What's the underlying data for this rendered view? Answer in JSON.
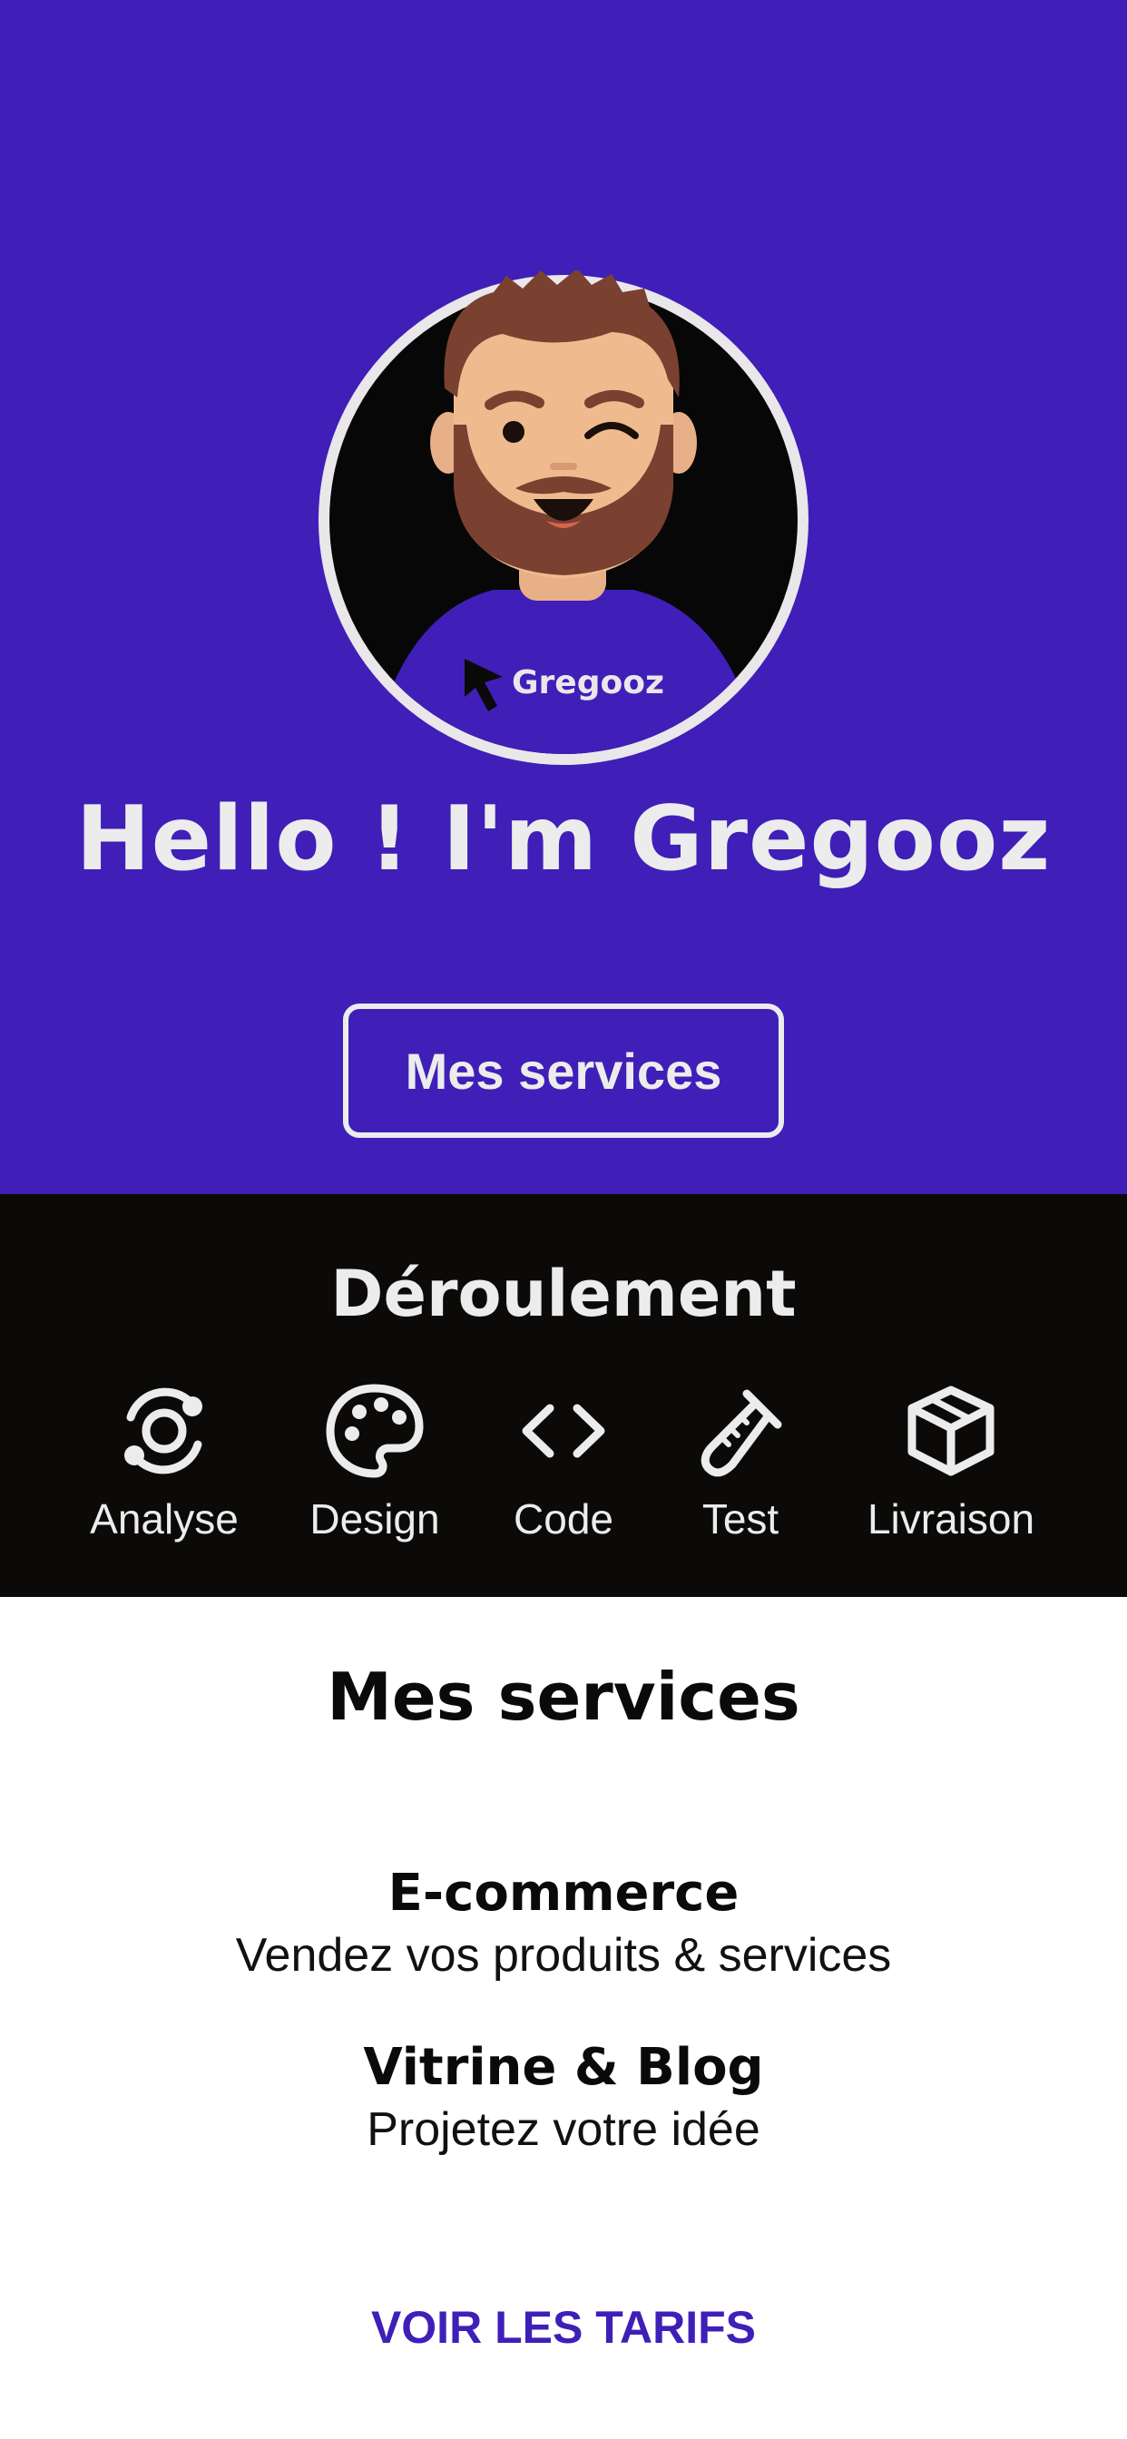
{
  "hero": {
    "title": "Hello ! I'm Gregooz",
    "button_label": "Mes services",
    "avatar_shirt_text": "Gregooz",
    "avatar_icon": "cartoon-avatar"
  },
  "process": {
    "title": "Déroulement",
    "steps": [
      {
        "label": "Analyse",
        "icon": "orbit-icon"
      },
      {
        "label": "Design",
        "icon": "palette-icon"
      },
      {
        "label": "Code",
        "icon": "code-brackets-icon"
      },
      {
        "label": "Test",
        "icon": "test-tube-icon"
      },
      {
        "label": "Livraison",
        "icon": "package-icon"
      }
    ]
  },
  "services": {
    "title": "Mes services",
    "items": [
      {
        "name": "E-commerce",
        "description": "Vendez vos produits & services"
      },
      {
        "name": "Vitrine & Blog",
        "description": "Projetez votre idée"
      }
    ],
    "cta_label": "VOIR LES TARIFS"
  },
  "colors": {
    "accent": "#3f1fb8",
    "dark": "#0b0a08",
    "light": "#ececec"
  }
}
